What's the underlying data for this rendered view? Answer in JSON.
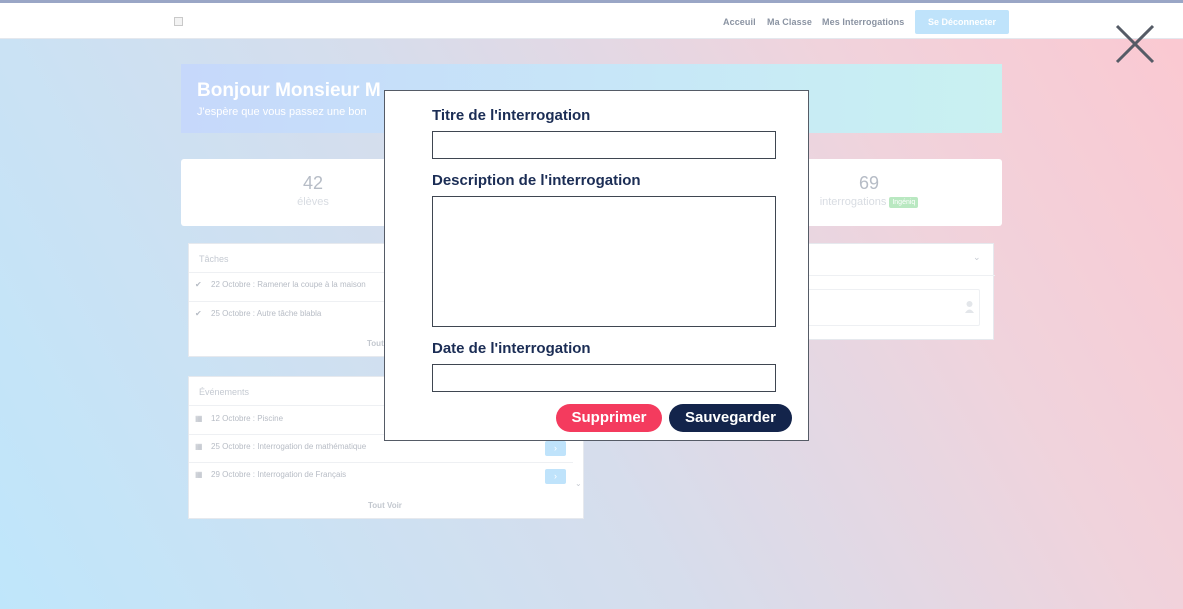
{
  "nav": {
    "links": [
      "Acceuil",
      "Ma Classe",
      "Mes Interrogations"
    ],
    "logout_label": "Se Déconnecter"
  },
  "welcome": {
    "title": "Bonjour Monsieur M",
    "subtitle": "J'espère que vous passez une bon"
  },
  "stats": [
    {
      "value": "42",
      "label": "élèves"
    },
    {
      "value": "69",
      "label": "interrogations",
      "badge": "Ingéniq"
    }
  ],
  "tasks": {
    "title": "Tâches",
    "items": [
      "22 Octobre : Ramener la coupe à la maison",
      "25 Octobre : Autre tâche blabla"
    ],
    "see_all": "Tout"
  },
  "events": {
    "title": "Événements",
    "items": [
      "12 Octobre : Piscine",
      "25 Octobre : Interrogation de mathématique",
      "29 Octobre : Interrogation de Français"
    ],
    "see_all": "Tout Voir"
  },
  "modal": {
    "title_label": "Titre de l'interrogation",
    "title_value": "",
    "description_label": "Description de l'interrogation",
    "description_value": "",
    "date_label": "Date de l'interrogation",
    "date_value": "",
    "delete_label": "Supprimer",
    "save_label": "Sauvegarder"
  },
  "colors": {
    "navy": "#13244b",
    "delete": "#f43b5e",
    "accent_light": "#bfe3fb"
  },
  "icons": [
    "close-icon",
    "check-icon",
    "calendar-icon",
    "chevron-right-icon",
    "chevron-down-icon",
    "user-icon"
  ]
}
